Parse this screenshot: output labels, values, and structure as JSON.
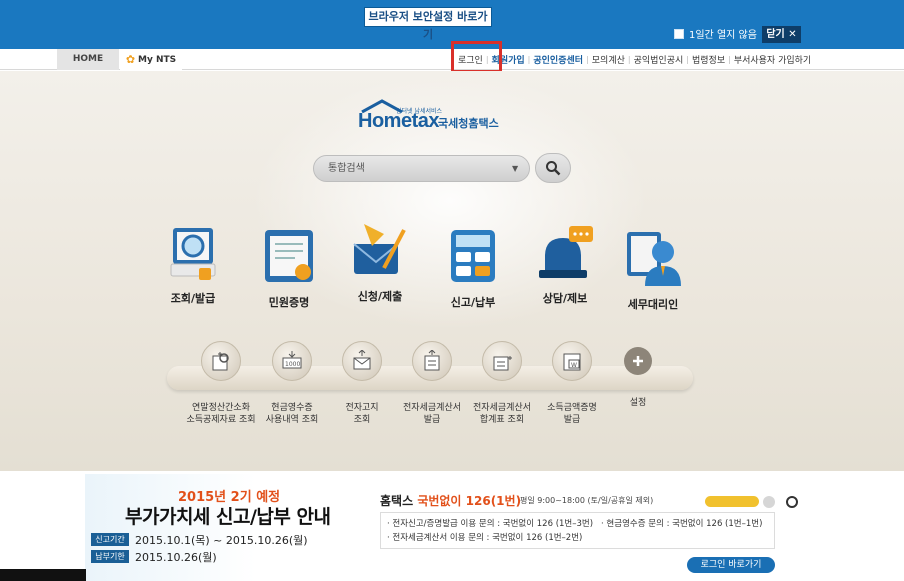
{
  "topbar": {
    "security_button": "브라우저 보안설정 바로가기",
    "one_week_label": "1일간 열지 않음",
    "close_label": "닫기 ✕"
  },
  "nav": {
    "home": "HOME",
    "my_nts": "My NTS",
    "links": [
      "로그인",
      "회원가입",
      "공인인증센터",
      "모의계산",
      "공익법인공시",
      "법령정보",
      "부서사용자 가입하기"
    ]
  },
  "logo": {
    "tagline": "인터넷 납세서비스",
    "name": "Hometax",
    "kr": "국세청홈택스"
  },
  "search": {
    "placeholder": "통합검색"
  },
  "menu": [
    "조회/발급",
    "민원증명",
    "신청/제출",
    "신고/납부",
    "상담/제보",
    "세무대리인"
  ],
  "quick": [
    "연말정산간소화\n소득공제자료 조회",
    "현금영수증\n사용내역 조회",
    "전자고지\n조회",
    "전자세금계산서\n발급",
    "전자세금계산서\n합계표 조회",
    "소득금액증명\n발급",
    "설정"
  ],
  "vat": {
    "year": "2015년 2기 예정",
    "title": "부가가치세 신고/납부 안내",
    "period_label": "신고기간",
    "period_value": "2015.10.1(목) ~ 2015.10.26(월)",
    "deadline_label": "납부기한",
    "deadline_value": "2015.10.26(월)"
  },
  "tel": {
    "title_prefix": "홈택스 ",
    "title_highlight": "국번없이 126(1번)",
    "hours": "평일 9:00~18:00 (토/일/공휴일 제외)",
    "line1a": "· 전자신고/증명발급 이용 문의 : 국번없이 126 (1번–3번)",
    "line1b": "· 현금영수증 문의 : 국번없이 126 (1번–1번)",
    "line2": "· 전자세금계산서 이용 문의 : 국번없이 126 (1번–2번)"
  },
  "login_go": "로그인 바로가기",
  "colors": {
    "brand_blue": "#1a78c0",
    "accent_orange": "#e2501a",
    "highlight_red": "#d9302a"
  }
}
